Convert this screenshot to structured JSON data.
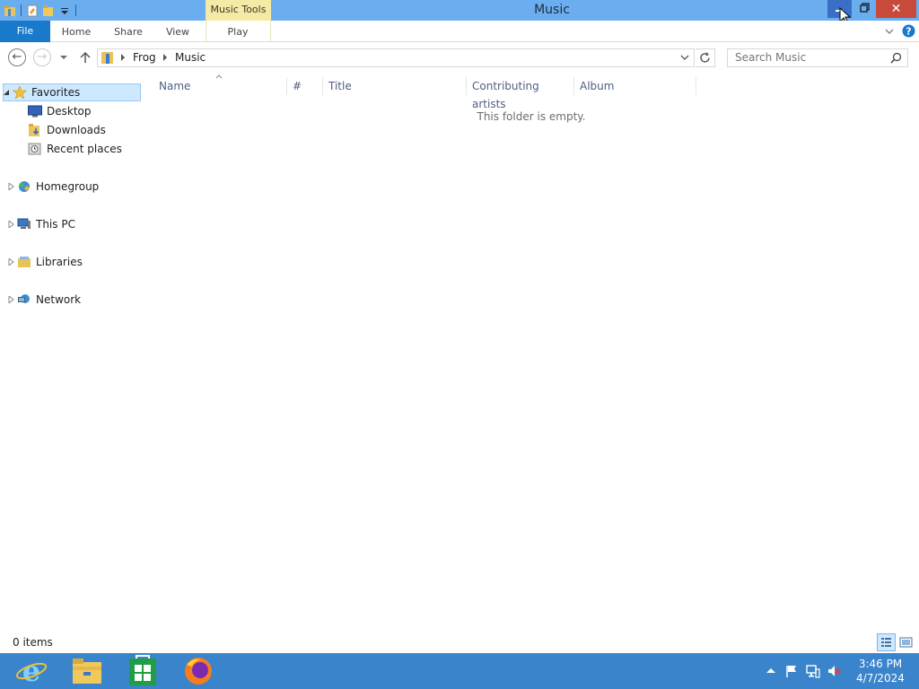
{
  "window": {
    "title": "Music",
    "context_tab": "Music Tools",
    "close_glyph": "✕"
  },
  "ribbon": {
    "tabs": [
      {
        "label": "File"
      },
      {
        "label": "Home"
      },
      {
        "label": "Share"
      },
      {
        "label": "View"
      },
      {
        "label": "Play"
      }
    ]
  },
  "address": {
    "segments": [
      "Frog",
      "Music"
    ],
    "search_placeholder": "Search Music"
  },
  "nav": {
    "favorites": "Favorites",
    "favorites_children": [
      "Desktop",
      "Downloads",
      "Recent places"
    ],
    "homegroup": "Homegroup",
    "this_pc": "This PC",
    "libraries": "Libraries",
    "network": "Network"
  },
  "columns": [
    "Name",
    "#",
    "Title",
    "Contributing artists",
    "Album"
  ],
  "content": {
    "empty_message": "This folder is empty."
  },
  "status": {
    "items": "0 items"
  },
  "taskbar": {
    "apps": [
      "internet-explorer-icon",
      "file-explorer-icon",
      "store-icon",
      "firefox-icon"
    ],
    "time": "3:46 PM",
    "date": "4/7/2024"
  },
  "colors": {
    "title_bar": "#6aaef0",
    "file_tab": "#1979ca",
    "context_tab": "#f4eaa5",
    "close_button": "#c74a3a",
    "selection": "#cde8ff",
    "taskbar": "#3a84cc"
  }
}
